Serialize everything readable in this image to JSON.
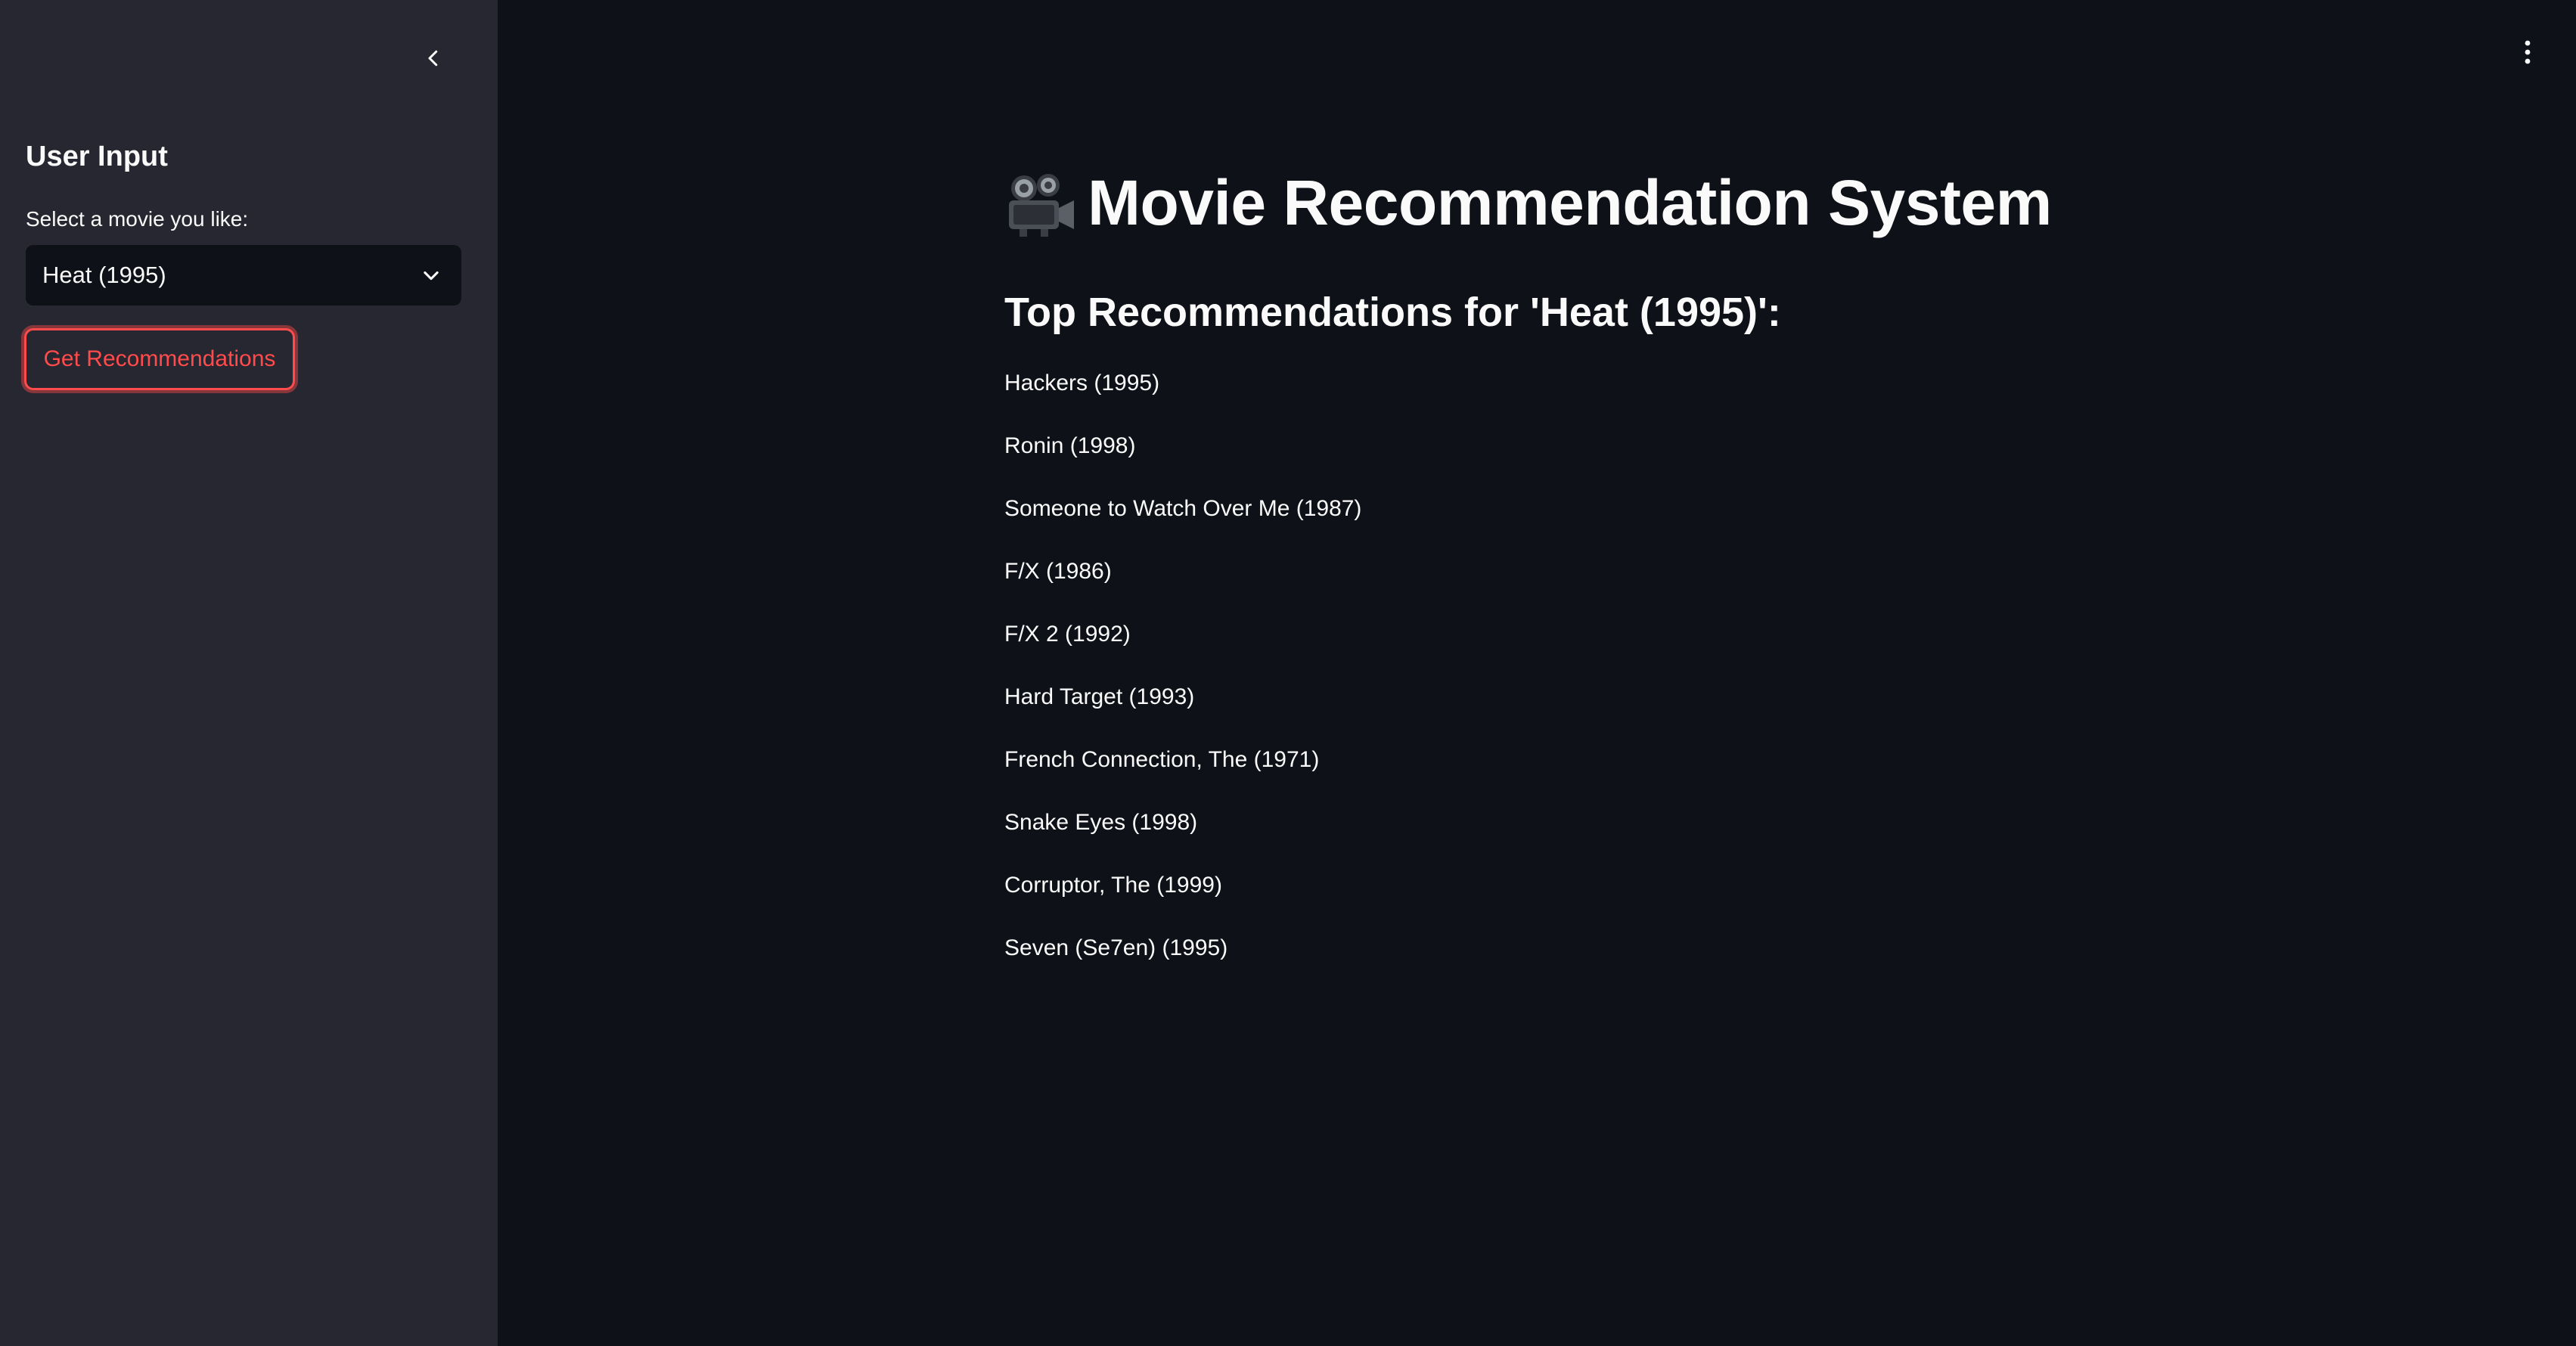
{
  "sidebar": {
    "header": "User Input",
    "select_label": "Select a movie you like:",
    "selected_movie": "Heat (1995)",
    "button_label": "Get Recommendations"
  },
  "main": {
    "title": "Movie Recommendation System",
    "subtitle": "Top Recommendations for 'Heat (1995)':",
    "recommendations": [
      "Hackers (1995)",
      "Ronin (1998)",
      "Someone to Watch Over Me (1987)",
      "F/X (1986)",
      "F/X 2 (1992)",
      "Hard Target (1993)",
      "French Connection, The (1971)",
      "Snake Eyes (1998)",
      "Corruptor, The (1999)",
      "Seven (Se7en) (1995)"
    ]
  },
  "icons": {
    "title_icon": "movie-camera-icon",
    "collapse": "chevron-left-icon",
    "menu": "vertical-dots-icon",
    "select_arrow": "chevron-down-icon"
  },
  "colors": {
    "main_bg": "#0e1117",
    "sidebar_bg": "#262730",
    "accent": "#ff4b4b",
    "text": "#fafafa"
  }
}
